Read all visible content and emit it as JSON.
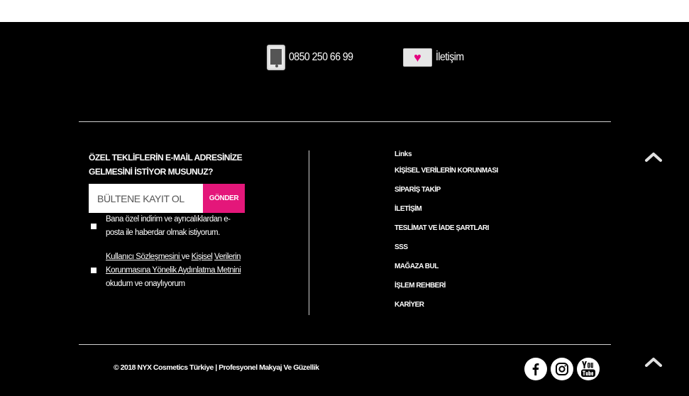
{
  "contact": {
    "phone_icon": "phone-icon",
    "phone": "0850 250 66 99",
    "mail_icon": "heart-envelope-icon",
    "contact_label": "İletişim"
  },
  "newsletter": {
    "title": "ÖZEL TEKLİFLERİN E-MAİL ADRESİNİZE GELMESİNİ İSTİYOR MUSUNUZ?",
    "input_placeholder": "BÜLTENE KAYIT OL",
    "submit_label": "GÖNDER",
    "consent_1": "Bana özel indirim ve ayrıcalıklardan e-posta ile haberdar olmak istiyorum.",
    "consent_2": {
      "link_1": "Kullanıcı Sözleşmesini ",
      "mid": "ve ",
      "link_2a": "Kişisel",
      "link_2b": "Verilerin Korunmasına Yönelik Aydınlatma Metnini ",
      "tail": "okudum ve onaylıyorum"
    }
  },
  "links": {
    "title": "Links",
    "items": [
      "KİŞİSEL VERİLERİN KORUNMASI",
      "SİPARİŞ TAKİP",
      "İLETİŞİM",
      "TESLİMAT VE İADE ŞARTLARI",
      "SSS",
      "MAĞAZA BUL",
      "İŞLEM REHBERİ",
      "KARİYER"
    ]
  },
  "footer": {
    "copyright": "© 2018 NYX Cosmetics Türkiye | Profesyonel Makyaj Ve Güzellik",
    "social": [
      "facebook-icon",
      "instagram-icon",
      "youtube-icon"
    ]
  },
  "colors": {
    "background": "#000000",
    "accent": "#e4177a",
    "text": "#ffffff"
  }
}
